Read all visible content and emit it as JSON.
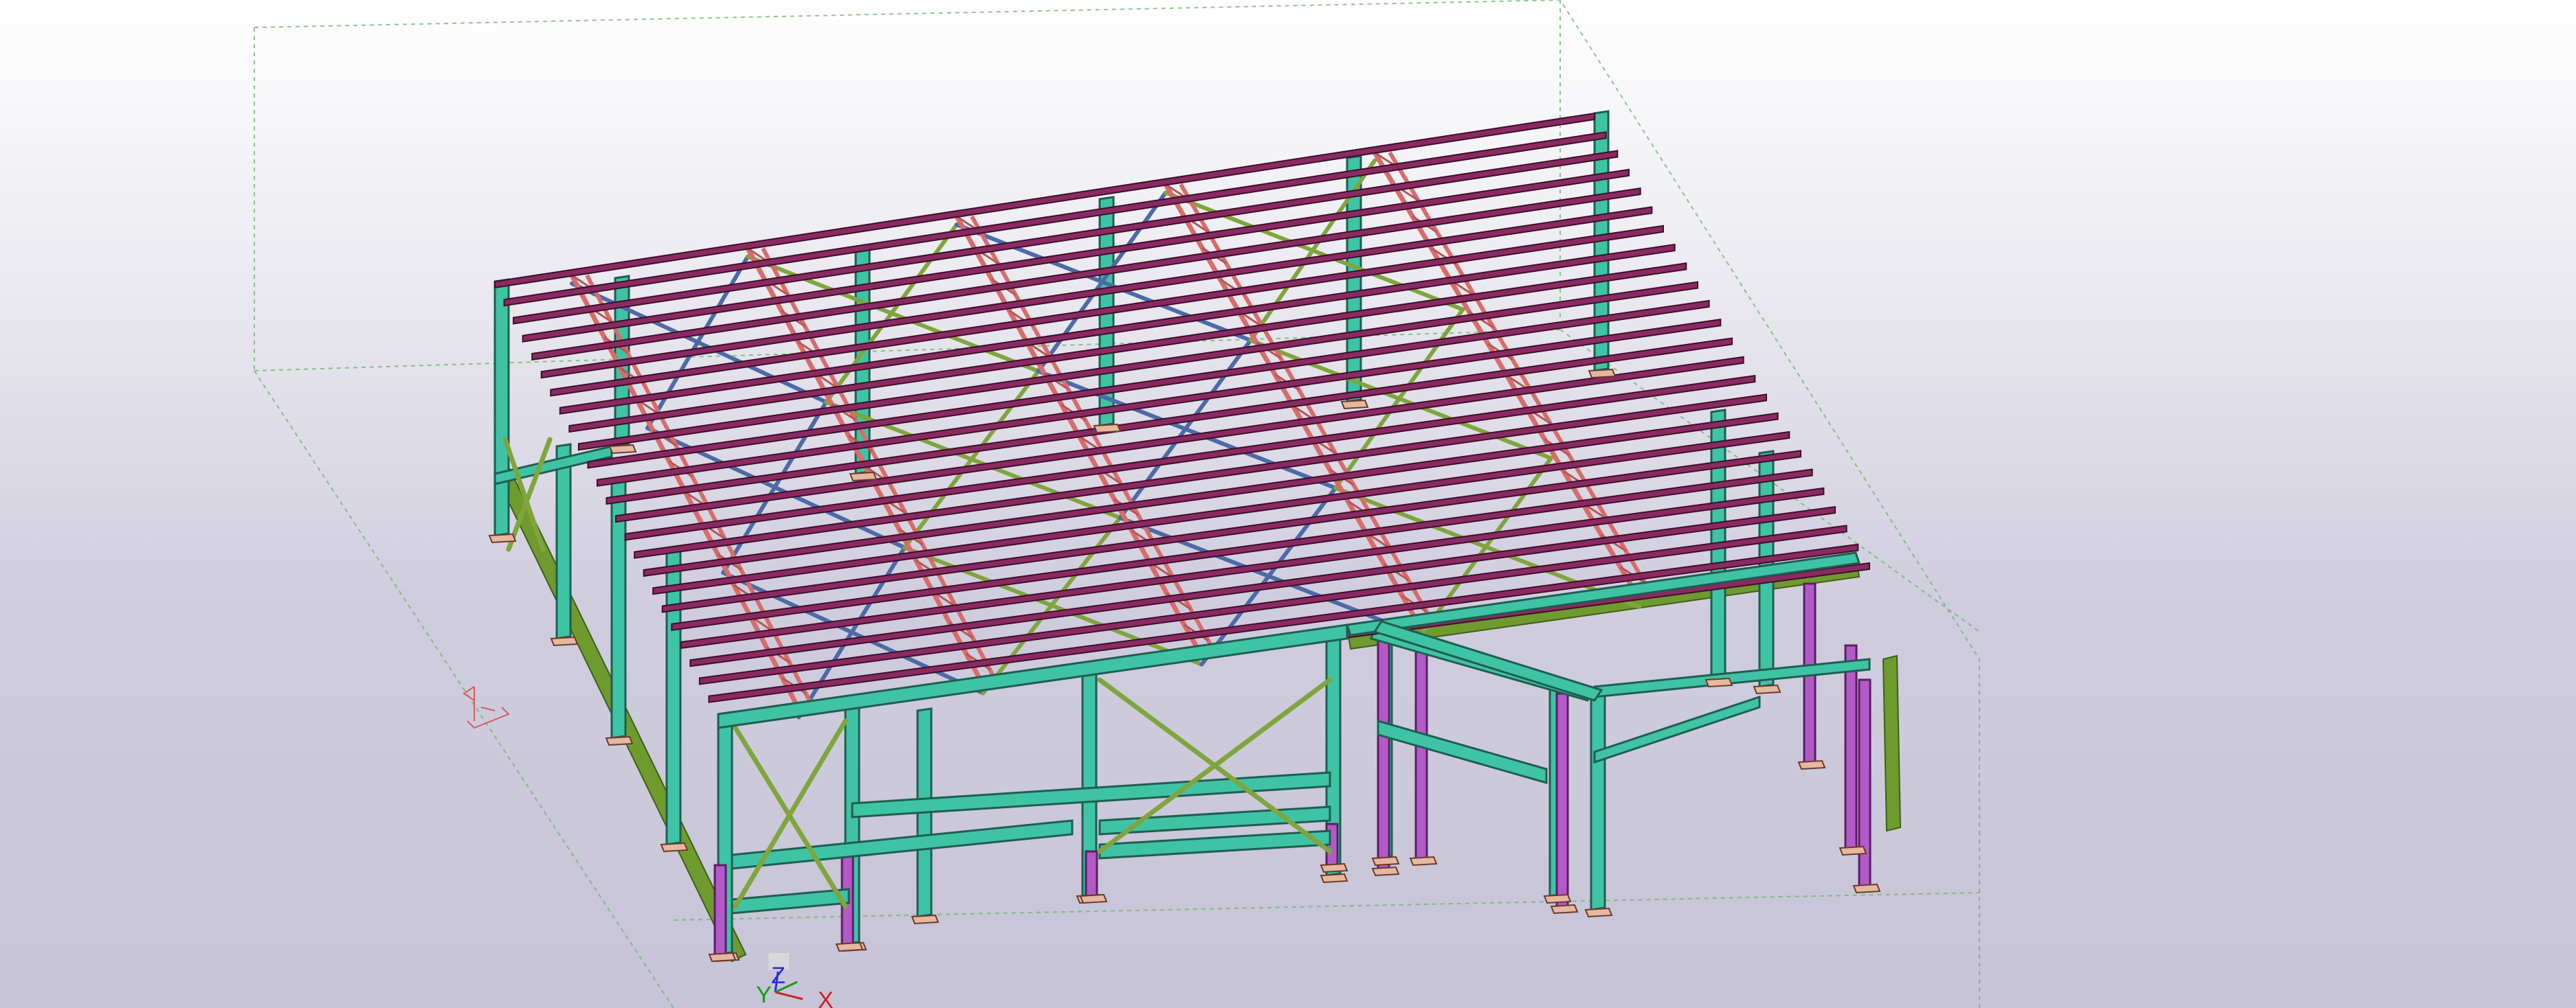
{
  "window": {
    "title": ""
  },
  "colors": {
    "background_top": "#ffffff",
    "background_bottom": "#c6c4d6",
    "column": "#3fc3a5",
    "column_edge": "#1f5e50",
    "purlin": "#8a2a62",
    "purlin_edge": "#3d0f2a",
    "rafter": "#d96b6b",
    "rafter_edge": "#6b2a2a",
    "brace_blue": "#4d6aa8",
    "brace_green": "#7fa53c",
    "edge_beam": "#6f9a2e",
    "post_purple": "#b459c8",
    "base_plate": "#e7b8a0",
    "work_area_line": "#6dbb6d",
    "axis_z": "#2a2fd6",
    "axis_y": "#1a9a1a",
    "axis_x": "#d22020",
    "ucs_red": "#d95c5c"
  },
  "axis_indicator": {
    "z_label": "Z",
    "y_label": "Y",
    "x_label": "X"
  },
  "icons": {
    "ucs": "coordinate-system-icon",
    "axis": "view-axis-icon"
  }
}
